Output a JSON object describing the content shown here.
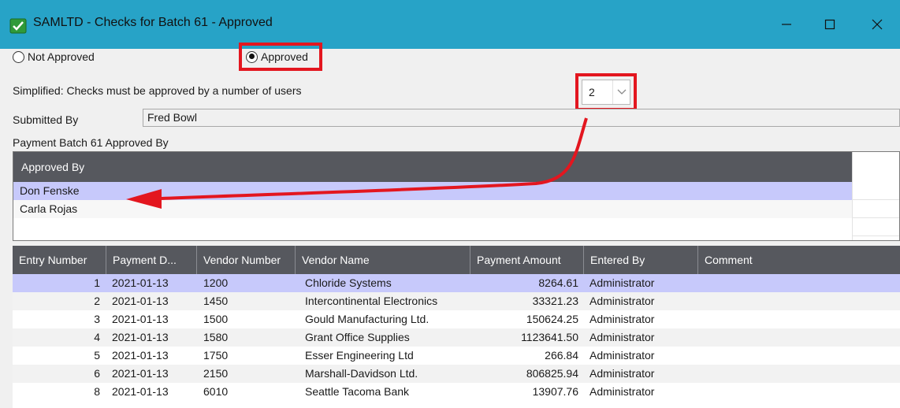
{
  "window": {
    "title": "SAMLTD - Checks for Batch 61 - Approved",
    "app_icon": "check-shield-icon",
    "minimize_icon": "minimize-icon",
    "maximize_icon": "maximize-icon",
    "close_icon": "close-icon"
  },
  "approval": {
    "not_approved_label": "Not Approved",
    "approved_label": "Approved",
    "selected": "Approved",
    "simplified_label": "Simplified: Checks must be approved by a number of users",
    "users_required": "2"
  },
  "submitted": {
    "label": "Submitted By",
    "value": "Fred Bowl"
  },
  "approved_by": {
    "section_label": "Payment Batch 61 Approved By",
    "column_header": "Approved By",
    "rows": [
      "Don Fenske",
      "Carla Rojas"
    ]
  },
  "entries": {
    "columns": [
      "Entry Number",
      "Payment D...",
      "Vendor Number",
      "Vendor Name",
      "Payment Amount",
      "Entered By",
      "Comment"
    ],
    "rows": [
      {
        "entry": "1",
        "date": "2021-01-13",
        "vendor_number": "1200",
        "vendor_name": "Chloride Systems",
        "amount": "8264.61",
        "entered_by": "Administrator",
        "comment": ""
      },
      {
        "entry": "2",
        "date": "2021-01-13",
        "vendor_number": "1450",
        "vendor_name": "Intercontinental Electronics",
        "amount": "33321.23",
        "entered_by": "Administrator",
        "comment": ""
      },
      {
        "entry": "3",
        "date": "2021-01-13",
        "vendor_number": "1500",
        "vendor_name": "Gould Manufacturing Ltd.",
        "amount": "150624.25",
        "entered_by": "Administrator",
        "comment": ""
      },
      {
        "entry": "4",
        "date": "2021-01-13",
        "vendor_number": "1580",
        "vendor_name": "Grant Office Supplies",
        "amount": "1123641.50",
        "entered_by": "Administrator",
        "comment": ""
      },
      {
        "entry": "5",
        "date": "2021-01-13",
        "vendor_number": "1750",
        "vendor_name": "Esser Engineering Ltd",
        "amount": "266.84",
        "entered_by": "Administrator",
        "comment": ""
      },
      {
        "entry": "6",
        "date": "2021-01-13",
        "vendor_number": "2150",
        "vendor_name": "Marshall-Davidson Ltd.",
        "amount": "806825.94",
        "entered_by": "Administrator",
        "comment": ""
      },
      {
        "entry": "8",
        "date": "2021-01-13",
        "vendor_number": "6010",
        "vendor_name": "Seattle Tacoma Bank",
        "amount": "13907.76",
        "entered_by": "Administrator",
        "comment": ""
      }
    ]
  },
  "colors": {
    "titlebar": "#27a3c7",
    "grid_header": "#56585e",
    "selected_row": "#c7c9fb",
    "highlight": "#e3161f"
  }
}
